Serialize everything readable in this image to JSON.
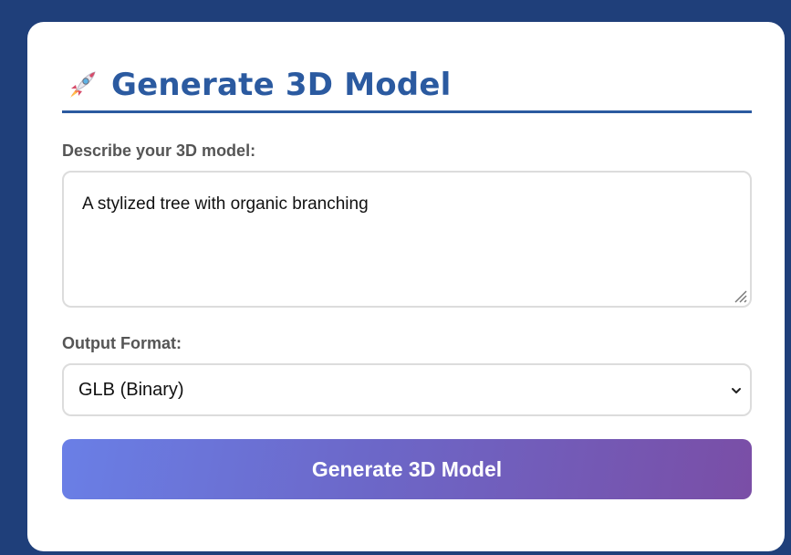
{
  "header": {
    "icon": "rocket-icon",
    "title": "Generate 3D Model"
  },
  "form": {
    "description_label": "Describe your 3D model:",
    "description_value": "A stylized tree with organic branching",
    "format_label": "Output Format:",
    "format_selected": "GLB (Binary)",
    "submit_label": "Generate 3D Model"
  },
  "colors": {
    "background": "#1f3f7a",
    "title": "#2b5aa0",
    "button_gradient_start": "#6a7fe6",
    "button_gradient_end": "#7a4ea6"
  }
}
